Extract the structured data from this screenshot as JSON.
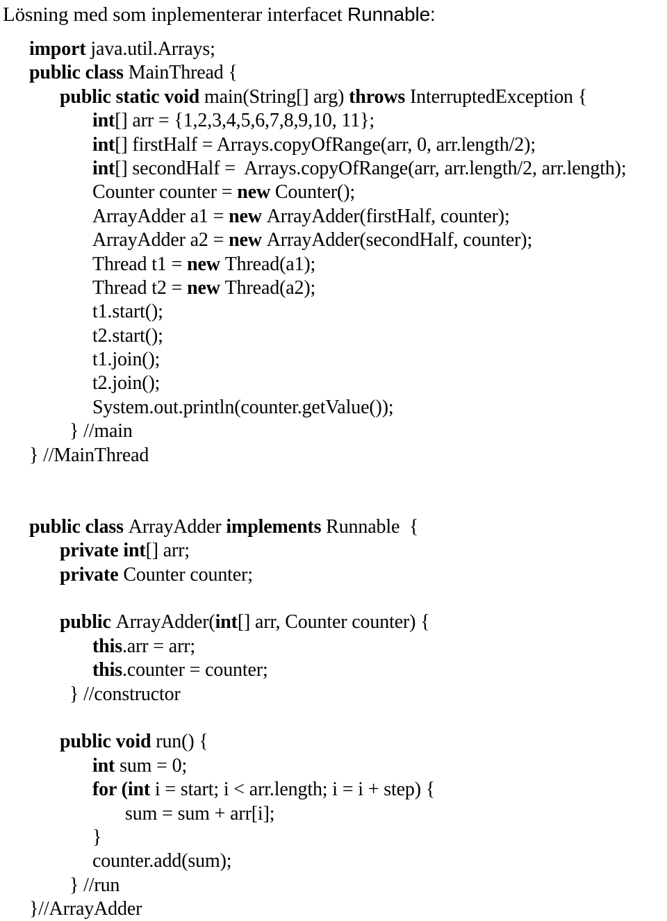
{
  "heading": {
    "text_serif": "Lösning med som inplementerar interfacet ",
    "text_sans": "Runnable:"
  },
  "code": {
    "lines": [
      {
        "id": "import",
        "indent": "ind0",
        "parts": [
          {
            "t": "import ",
            "b": true
          },
          {
            "t": "java.util.Arrays;",
            "b": false
          }
        ]
      },
      {
        "id": "class-mainthread",
        "indent": "ind0",
        "parts": [
          {
            "t": "public class ",
            "b": true
          },
          {
            "t": "MainThread {",
            "b": false
          }
        ]
      },
      {
        "id": "main-signature",
        "indent": "ind1",
        "parts": [
          {
            "t": "public static void ",
            "b": true
          },
          {
            "t": "main(String[] arg) ",
            "b": false
          },
          {
            "t": "throws ",
            "b": true
          },
          {
            "t": "InterruptedException {",
            "b": false
          }
        ]
      },
      {
        "id": "decl-arr",
        "indent": "ind2",
        "parts": [
          {
            "t": "int",
            "b": true
          },
          {
            "t": "[] arr = {1,2,3,4,5,6,7,8,9,10, 11};",
            "b": false
          }
        ]
      },
      {
        "id": "decl-firsthalf",
        "indent": "ind2",
        "parts": [
          {
            "t": "int",
            "b": true
          },
          {
            "t": "[] firstHalf = Arrays.copyOfRange(arr, 0, arr.length/2);",
            "b": false
          }
        ]
      },
      {
        "id": "decl-secondhalf",
        "indent": "ind2",
        "parts": [
          {
            "t": "int",
            "b": true
          },
          {
            "t": "[] secondHalf =  Arrays.copyOfRange(arr, arr.length/2, arr.length);",
            "b": false
          }
        ]
      },
      {
        "id": "decl-counter",
        "indent": "ind2",
        "parts": [
          {
            "t": "Counter counter = ",
            "b": false
          },
          {
            "t": "new ",
            "b": true
          },
          {
            "t": "Counter();",
            "b": false
          }
        ]
      },
      {
        "id": "decl-a1",
        "indent": "ind2",
        "parts": [
          {
            "t": "ArrayAdder a1 = ",
            "b": false
          },
          {
            "t": "new ",
            "b": true
          },
          {
            "t": "ArrayAdder(firstHalf, counter);",
            "b": false
          }
        ]
      },
      {
        "id": "decl-a2",
        "indent": "ind2",
        "parts": [
          {
            "t": "ArrayAdder a2 = ",
            "b": false
          },
          {
            "t": "new ",
            "b": true
          },
          {
            "t": "ArrayAdder(secondHalf, counter);",
            "b": false
          }
        ]
      },
      {
        "id": "decl-t1",
        "indent": "ind2",
        "parts": [
          {
            "t": "Thread t1 = ",
            "b": false
          },
          {
            "t": "new ",
            "b": true
          },
          {
            "t": "Thread(a1);",
            "b": false
          }
        ]
      },
      {
        "id": "decl-t2",
        "indent": "ind2",
        "parts": [
          {
            "t": "Thread t2 = ",
            "b": false
          },
          {
            "t": "new ",
            "b": true
          },
          {
            "t": "Thread(a2);",
            "b": false
          }
        ]
      },
      {
        "id": "t1-start",
        "indent": "ind2",
        "parts": [
          {
            "t": "t1.start();",
            "b": false
          }
        ]
      },
      {
        "id": "t2-start",
        "indent": "ind2",
        "parts": [
          {
            "t": "t2.start();",
            "b": false
          }
        ]
      },
      {
        "id": "t1-join",
        "indent": "ind2",
        "parts": [
          {
            "t": "t1.join();",
            "b": false
          }
        ]
      },
      {
        "id": "t2-join",
        "indent": "ind2",
        "parts": [
          {
            "t": "t2.join();",
            "b": false
          }
        ]
      },
      {
        "id": "println",
        "indent": "ind2",
        "parts": [
          {
            "t": "System.out.println(counter.getValue());",
            "b": false
          }
        ]
      },
      {
        "id": "close-main",
        "indent": "indclose1",
        "parts": [
          {
            "t": "} //main",
            "b": false
          }
        ]
      },
      {
        "id": "close-mainthread",
        "indent": "ind0",
        "parts": [
          {
            "t": "} //MainThread",
            "b": false
          }
        ]
      },
      {
        "id": "blank-1",
        "indent": "ind0",
        "blank": true,
        "parts": []
      },
      {
        "id": "blank-2",
        "indent": "ind0",
        "blank": true,
        "parts": []
      },
      {
        "id": "class-arrayadder",
        "indent": "ind0",
        "parts": [
          {
            "t": "public class ",
            "b": true
          },
          {
            "t": "ArrayAdder ",
            "b": false
          },
          {
            "t": "implements ",
            "b": true
          },
          {
            "t": "Runnable  {",
            "b": false
          }
        ]
      },
      {
        "id": "field-arr",
        "indent": "ind1",
        "parts": [
          {
            "t": "private int",
            "b": true
          },
          {
            "t": "[] arr;",
            "b": false
          }
        ]
      },
      {
        "id": "field-counter",
        "indent": "ind1",
        "parts": [
          {
            "t": "private ",
            "b": true
          },
          {
            "t": "Counter counter;",
            "b": false
          }
        ]
      },
      {
        "id": "blank-3",
        "indent": "ind0",
        "blank": true,
        "parts": []
      },
      {
        "id": "ctor-signature",
        "indent": "ind1",
        "parts": [
          {
            "t": "public ",
            "b": true
          },
          {
            "t": "ArrayAdder(",
            "b": false
          },
          {
            "t": "int",
            "b": true
          },
          {
            "t": "[] arr, Counter counter) {",
            "b": false
          }
        ]
      },
      {
        "id": "ctor-this-arr",
        "indent": "ind2",
        "parts": [
          {
            "t": "this",
            "b": true
          },
          {
            "t": ".arr = arr;",
            "b": false
          }
        ]
      },
      {
        "id": "ctor-this-counter",
        "indent": "ind2",
        "parts": [
          {
            "t": "this",
            "b": true
          },
          {
            "t": ".counter = counter;",
            "b": false
          }
        ]
      },
      {
        "id": "close-ctor",
        "indent": "indclose1",
        "parts": [
          {
            "t": "} //constructor",
            "b": false
          }
        ]
      },
      {
        "id": "blank-4",
        "indent": "ind0",
        "blank": true,
        "parts": []
      },
      {
        "id": "run-signature",
        "indent": "ind1",
        "parts": [
          {
            "t": "public void ",
            "b": true
          },
          {
            "t": "run() {",
            "b": false
          }
        ]
      },
      {
        "id": "decl-sum",
        "indent": "ind2",
        "parts": [
          {
            "t": "int ",
            "b": true
          },
          {
            "t": "sum = 0;",
            "b": false
          }
        ]
      },
      {
        "id": "for-loop",
        "indent": "ind2",
        "parts": [
          {
            "t": "for (",
            "b": true
          },
          {
            "t": "int",
            "b": true
          },
          {
            "t": " i = start; i < arr.length; i = i + step) {",
            "b": false
          }
        ]
      },
      {
        "id": "sum-accumulate",
        "indent": "ind3",
        "parts": [
          {
            "t": "sum = sum + arr[i];",
            "b": false
          }
        ]
      },
      {
        "id": "close-for",
        "indent": "ind2",
        "parts": [
          {
            "t": "}",
            "b": false
          }
        ]
      },
      {
        "id": "counter-add",
        "indent": "ind2",
        "parts": [
          {
            "t": "counter.add(sum);",
            "b": false
          }
        ]
      },
      {
        "id": "close-run",
        "indent": "indclose1",
        "parts": [
          {
            "t": "} //run",
            "b": false
          }
        ]
      },
      {
        "id": "close-arrayadder",
        "indent": "ind0",
        "parts": [
          {
            "t": "}//ArrayAdder",
            "b": false
          }
        ]
      }
    ]
  }
}
